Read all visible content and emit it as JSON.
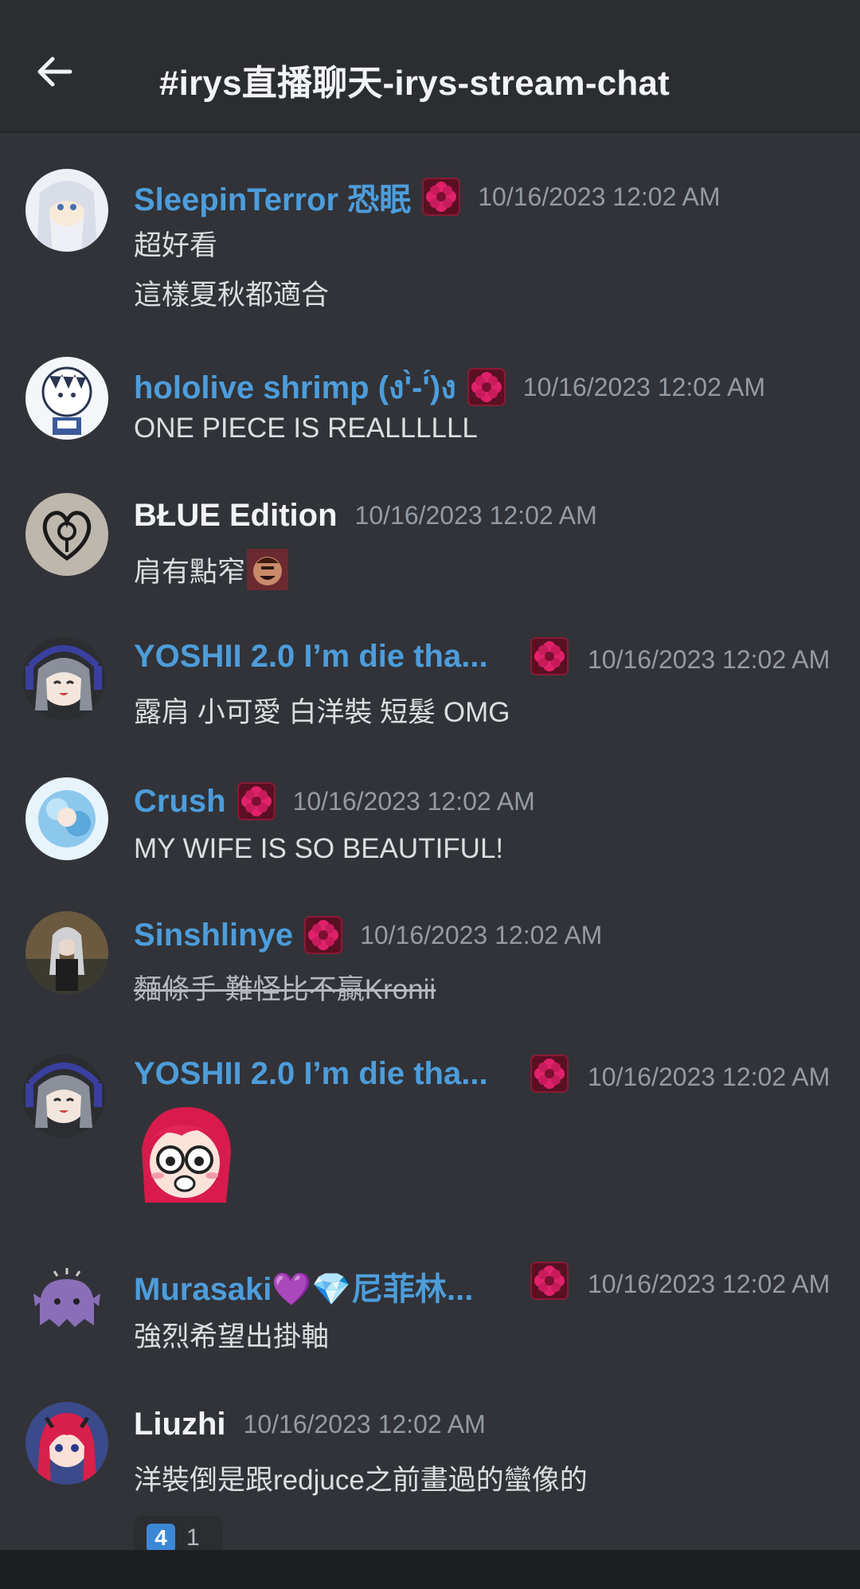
{
  "header": {
    "channel": "#irys直播聊天-irys-stream-chat",
    "back_icon": "arrow-left-icon"
  },
  "messages": [
    {
      "username": "SleepinTerror 恐眠",
      "name_color": "#4d9ddb",
      "has_role_icon": true,
      "timestamp": "10/16/2023 12:02 AM",
      "lines": [
        "超好看",
        "這樣夏秋都適合"
      ]
    },
    {
      "username": "hololive shrimp (ง'̀-'́)ง",
      "name_color": "#4d9ddb",
      "has_role_icon": true,
      "timestamp": "10/16/2023 12:02 AM",
      "lines": [
        "ONE PIECE IS REALLLLLL"
      ]
    },
    {
      "username": "BŁUE Edition",
      "name_color": "#f2f3f5",
      "has_role_icon": false,
      "timestamp": "10/16/2023 12:02 AM",
      "lines": [
        "肩有點窄"
      ],
      "inline_emoji": "laughing-face-emoji"
    },
    {
      "username": "YOSHII 2.0 I’m die tha...",
      "name_color": "#4d9ddb",
      "has_role_icon": true,
      "timestamp": "10/16/2023 12:02 AM",
      "lines": [
        "露肩 小可愛 白洋裝 短髮 OMG"
      ]
    },
    {
      "username": "Crush",
      "name_color": "#4d9ddb",
      "has_role_icon": true,
      "timestamp": "10/16/2023 12:02 AM",
      "lines": [
        "MY WIFE IS SO BEAUTIFUL!"
      ]
    },
    {
      "username": "Sinshlinye",
      "name_color": "#4d9ddb",
      "has_role_icon": true,
      "timestamp": "10/16/2023 12:02 AM",
      "lines": [
        "麵條手 難怪比不贏Kronii"
      ],
      "strikethrough": true
    },
    {
      "username": "YOSHII 2.0 I’m die tha...",
      "name_color": "#4d9ddb",
      "has_role_icon": true,
      "timestamp": "10/16/2023 12:02 AM",
      "lines": [],
      "sticker": "shocked-girl-emoji"
    },
    {
      "username": "Murasaki💜💎尼菲林...",
      "name_color": "#4d9ddb",
      "has_role_icon": true,
      "timestamp": "10/16/2023 12:02 AM",
      "lines": [
        "強烈希望出掛軸"
      ]
    },
    {
      "username": "Liuzhi",
      "name_color": "#f2f3f5",
      "has_role_icon": false,
      "timestamp": "10/16/2023 12:02 AM",
      "lines": [
        "洋裝倒是跟redjuce之前畫過的蠻像的"
      ]
    }
  ],
  "reaction": {
    "emoji": "4",
    "count": "1"
  },
  "colors": {
    "background": "#313338",
    "header": "#2b2d31",
    "link_name": "#4d9ddb",
    "timestamp": "#949ba4",
    "role_icon": "#c2185b"
  }
}
